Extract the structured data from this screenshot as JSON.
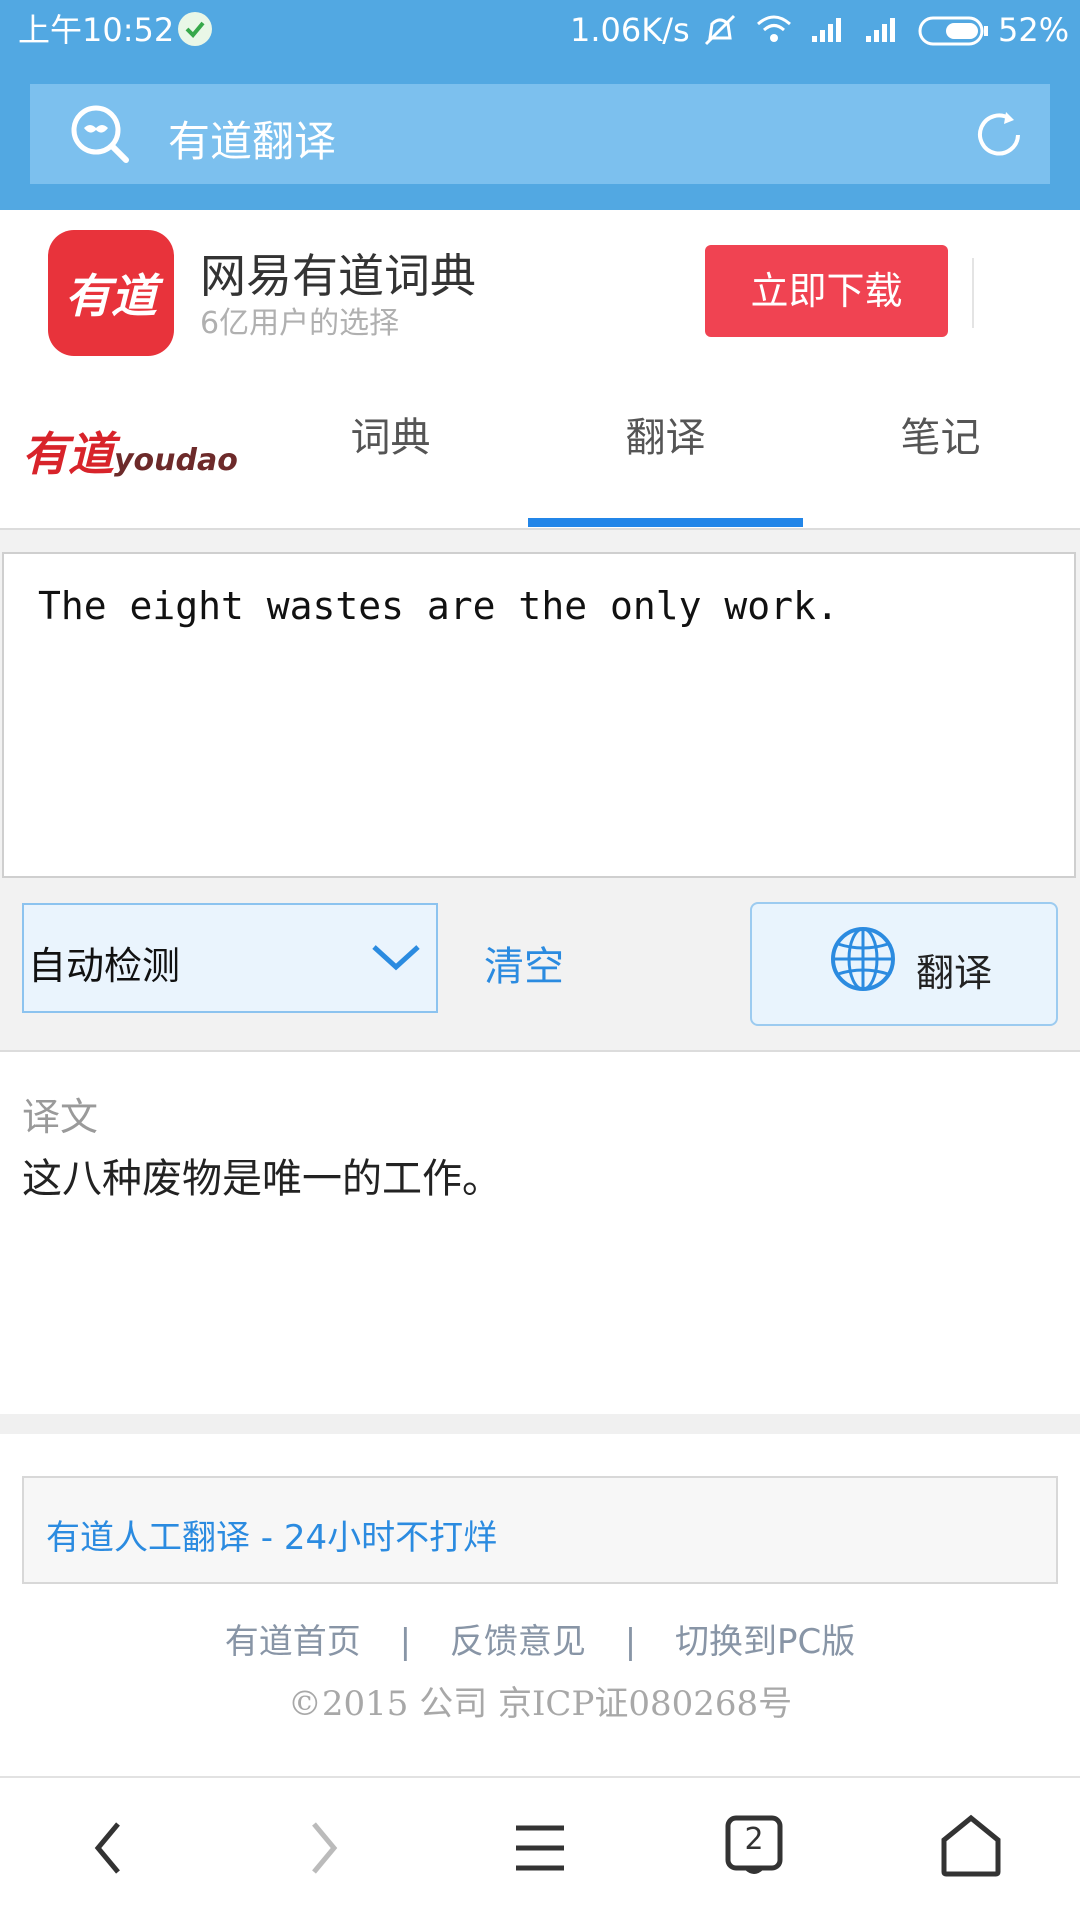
{
  "status_bar": {
    "time": "上午10:52",
    "net_speed": "1.06K/s",
    "battery": "52%",
    "icons": [
      "vpn-shield-icon",
      "mute-icon",
      "wifi-icon",
      "signal-icon",
      "signal-icon",
      "battery-icon"
    ]
  },
  "browser_bar": {
    "query": "有道翻译",
    "icons": [
      "search-mask-icon",
      "refresh-icon"
    ]
  },
  "promo": {
    "app_icon_text": "有道",
    "app_name": "网易有道词典",
    "tagline": "6亿用户的选择",
    "download_label": "立即下载"
  },
  "nav": {
    "logo_cn": "有道",
    "logo_en": "youdao",
    "tabs": [
      {
        "label": "词典"
      },
      {
        "label": "翻译"
      },
      {
        "label": "笔记"
      }
    ],
    "active_tab_index": 1
  },
  "translator": {
    "input_text": "The eight wastes are the only work.",
    "language_select": "自动检测",
    "clear_label": "清空",
    "translate_label": "翻译",
    "result_title": "译文",
    "result_text": "这八种废物是唯一的工作。"
  },
  "footer": {
    "human_translate_link": "有道人工翻译 - 24小时不打烊",
    "links": [
      "有道首页",
      "反馈意见",
      "切换到PC版"
    ],
    "separator": "|",
    "copyright": "©2015 公司 京ICP证080268号"
  },
  "bottom_nav": {
    "tab_count": "2",
    "icons": [
      "back-icon",
      "forward-icon",
      "menu-icon",
      "tabs-icon",
      "home-icon"
    ]
  },
  "colors": {
    "top_blue": "#52a8e2",
    "search_box": "#7cc0ee",
    "accent_blue": "#2386e8",
    "download_red": "#f04352",
    "app_red": "#e8333b",
    "link_blue": "#2b8be0"
  }
}
